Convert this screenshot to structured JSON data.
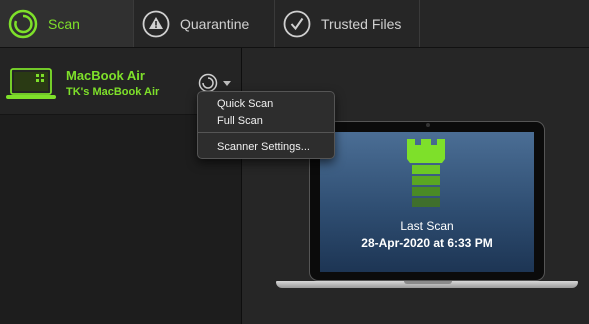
{
  "tabs": [
    {
      "label": "Scan",
      "icon": "scan-icon",
      "active": true
    },
    {
      "label": "Quarantine",
      "icon": "warning-icon",
      "active": false
    },
    {
      "label": "Trusted Files",
      "icon": "checkmark-icon",
      "active": false
    }
  ],
  "device": {
    "name": "MacBook Air",
    "owner": "TK's MacBook Air",
    "icon": "laptop-icon"
  },
  "menu": {
    "items": [
      "Quick Scan",
      "Full Scan",
      "Scanner Settings..."
    ]
  },
  "status": {
    "title": "Last Scan",
    "date": "28-Apr-2020 at 6:33 PM",
    "icon": "castle-tower-icon"
  },
  "colors": {
    "accent": "#7ee02a",
    "background": "#1e1e1e",
    "screen": "#4b6e95"
  }
}
